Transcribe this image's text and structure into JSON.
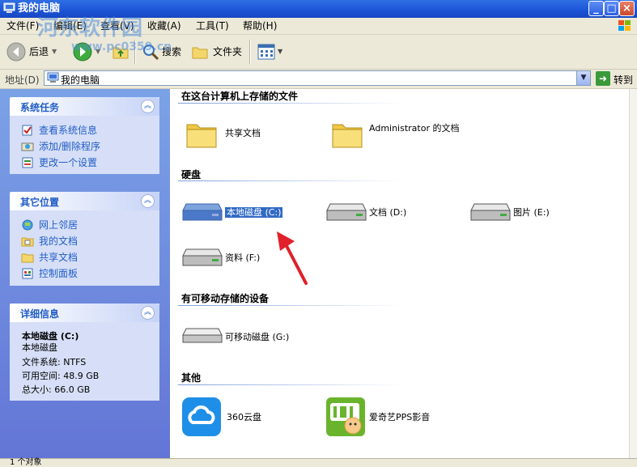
{
  "window": {
    "title": "我的电脑"
  },
  "menu": {
    "items": [
      "文件(F)",
      "编辑(E)",
      "查看(V)",
      "收藏(A)",
      "工具(T)",
      "帮助(H)"
    ]
  },
  "toolbar": {
    "back": "后退",
    "search": "搜索",
    "folders": "文件夹"
  },
  "watermark": {
    "line1": "河东软件园",
    "line2": "www.pc0359.cn"
  },
  "address": {
    "label": "地址(D)",
    "value": "我的电脑",
    "go": "转到"
  },
  "tasks": {
    "system": {
      "title": "系统任务",
      "items": [
        "查看系统信息",
        "添加/删除程序",
        "更改一个设置"
      ]
    },
    "other": {
      "title": "其它位置",
      "items": [
        "网上邻居",
        "我的文档",
        "共享文档",
        "控制面板"
      ]
    },
    "details": {
      "title": "详细信息",
      "name": "本地磁盘 (C:)",
      "type": "本地磁盘",
      "fs": "文件系统: NTFS",
      "free": "可用空间: 48.9 GB",
      "total": "总大小: 66.0 GB"
    }
  },
  "groups": {
    "stored": {
      "title": "在这台计算机上存储的文件",
      "items": [
        "共享文档",
        "Administrator 的文档"
      ]
    },
    "drives": {
      "title": "硬盘",
      "items": [
        "本地磁盘 (C:)",
        "文档 (D:)",
        "图片 (E:)",
        "资料 (F:)"
      ]
    },
    "removable": {
      "title": "有可移动存储的设备",
      "items": [
        "可移动磁盘 (G:)"
      ]
    },
    "other": {
      "title": "其他",
      "items": [
        "360云盘",
        "爱奇艺PPS影音"
      ]
    }
  },
  "status": {
    "text": "1 个对象"
  },
  "colors": {
    "titlebar": "#1c54d6",
    "taskpane": "#6f8fdc",
    "link": "#215dc6",
    "selected": "#316ac5"
  },
  "selected_item": "drives.0"
}
